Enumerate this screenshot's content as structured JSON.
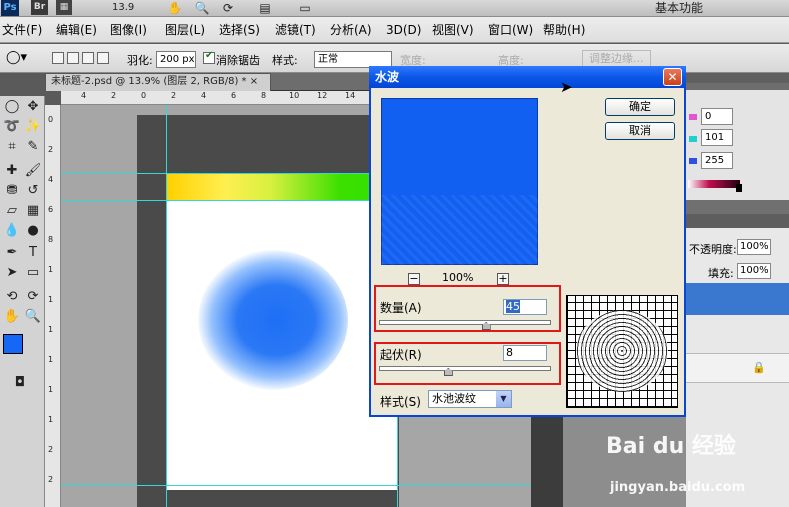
{
  "app": {
    "logo": "Ps",
    "bridge": "Br",
    "zoom": "13.9",
    "workspace": "基本功能"
  },
  "menu": [
    "文件(F)",
    "编辑(E)",
    "图像(I)",
    "图层(L)",
    "选择(S)",
    "滤镜(T)",
    "分析(A)",
    "3D(D)",
    "视图(V)",
    "窗口(W)",
    "帮助(H)"
  ],
  "options": {
    "feather_label": "羽化:",
    "feather_value": "200 px",
    "antialias_label": "消除锯齿",
    "style_label": "样式:",
    "style_value": "正常",
    "width_label": "宽度:",
    "height_label": "高度:",
    "refine_edge": "调整边缘..."
  },
  "document": {
    "tab_title": "未标题-2.psd @ 13.9% (图层 2, RGB/8) * ×"
  },
  "rulers": {
    "top": [
      "4",
      "2",
      "0",
      "2",
      "4",
      "6",
      "8",
      "10",
      "12",
      "14"
    ],
    "left": [
      "0",
      "2",
      "4",
      "6",
      "8",
      "1",
      "1",
      "1",
      "1",
      "1",
      "1",
      "2",
      "2"
    ]
  },
  "color_panel": {
    "r": "0",
    "g": "101",
    "b": "255"
  },
  "layers_panel": {
    "opacity_label": "不透明度:",
    "opacity_value": "100%",
    "fill_label": "填充:",
    "fill_value": "100%"
  },
  "dialog": {
    "title": "水波",
    "ok": "确定",
    "cancel": "取消",
    "zoom_minus": "−",
    "zoom_plus": "+",
    "zoom_value": "100%",
    "amount_label": "数量(A)",
    "amount_value": "45",
    "ridges_label": "起伏(R)",
    "ridges_value": "8",
    "style_label": "样式(S)",
    "style_value": "水池波纹",
    "amount_fraction": 0.62,
    "ridges_fraction": 0.4
  },
  "watermark": {
    "line1": "Bai du 经验",
    "line2": "jingyan.baidu.com"
  },
  "colors": {
    "accent": "#1667f5",
    "dialog_title": "#0a58e8",
    "highlight": "#e01818"
  }
}
